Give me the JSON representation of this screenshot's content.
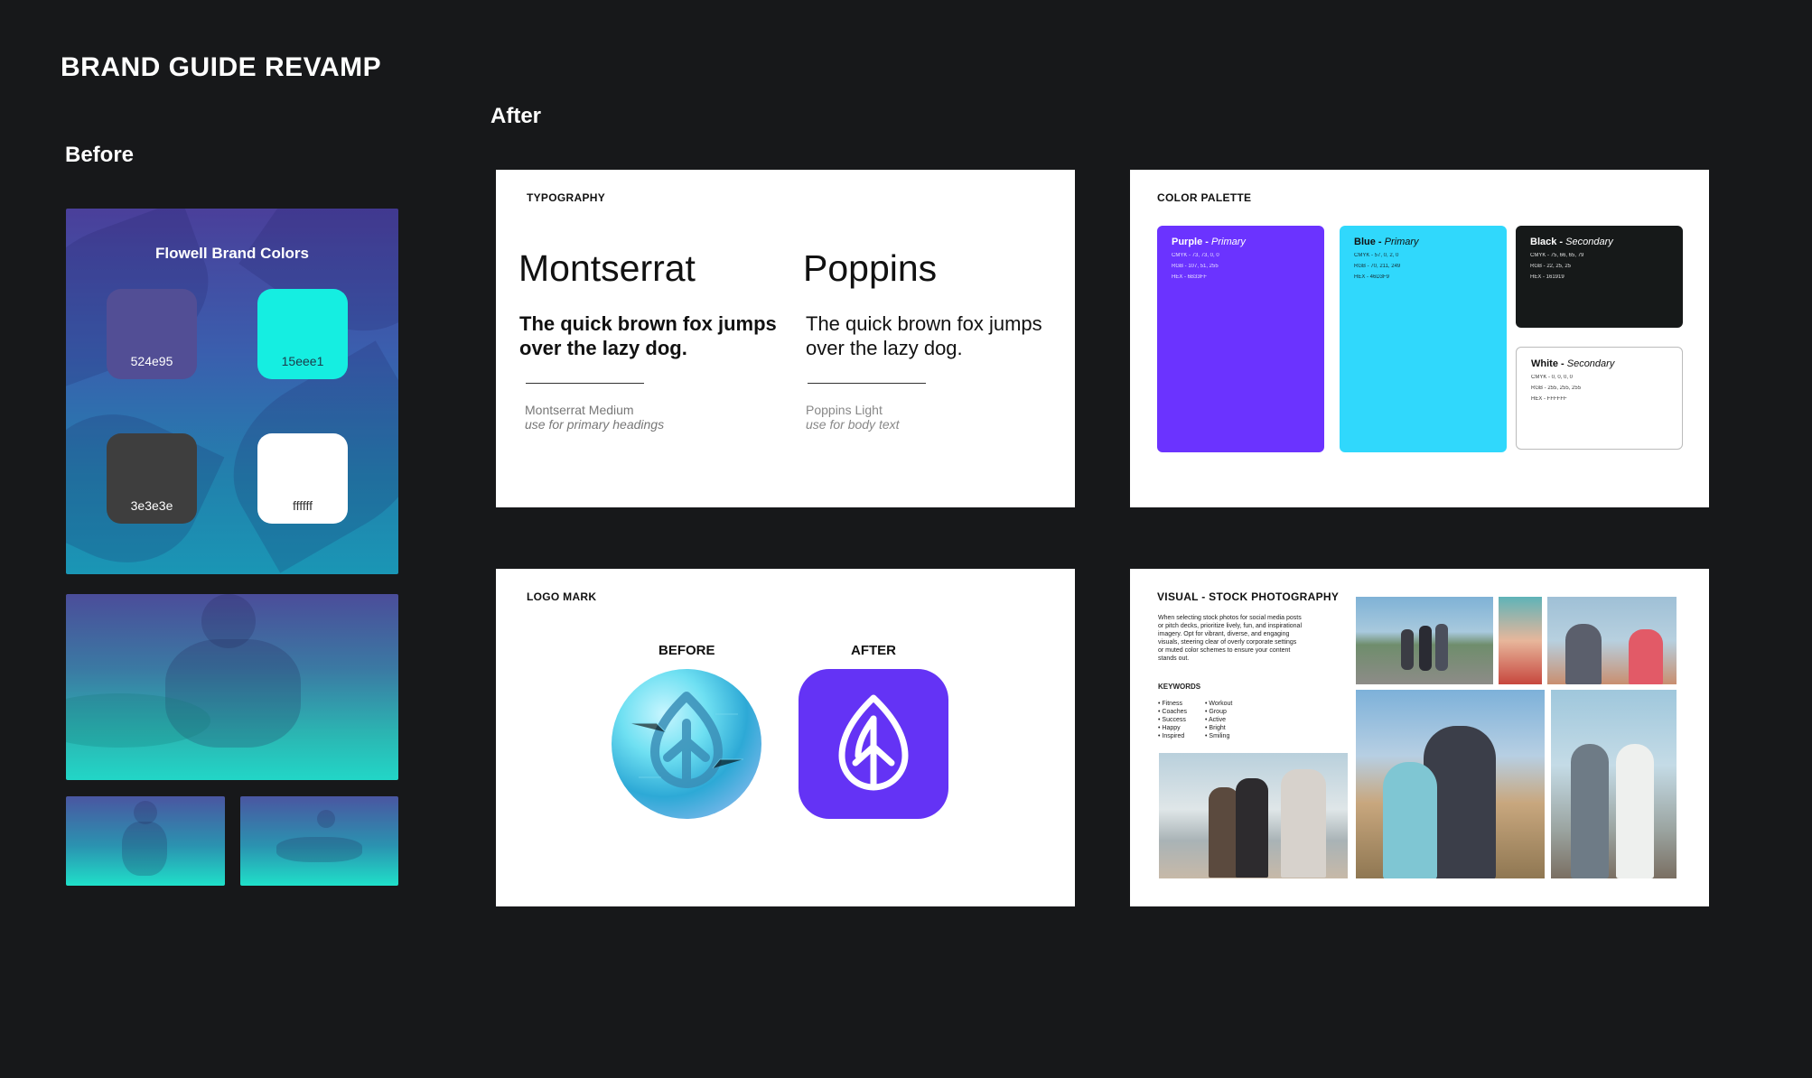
{
  "page": {
    "title": "BRAND GUIDE REVAMP",
    "before_label": "Before",
    "after_label": "After"
  },
  "before": {
    "card_title": "Flowell Brand Colors",
    "swatches": [
      {
        "label": "524e95",
        "color": "#524e95"
      },
      {
        "label": "15eee1",
        "color": "#15eee1"
      },
      {
        "label": "3e3e3e",
        "color": "#3e3e3e"
      },
      {
        "label": "ffffff",
        "color": "#ffffff"
      }
    ]
  },
  "typography": {
    "label": "TYPOGRAPHY",
    "fonts": [
      {
        "name": "Montserrat",
        "sample": "The quick brown fox jumps over the lazy dog.",
        "weight": "Montserrat Medium",
        "usage": "use for primary headings"
      },
      {
        "name": "Poppins",
        "sample": "The quick brown fox jumps over the lazy dog.",
        "weight": "Poppins Light",
        "usage": "use for body text"
      }
    ]
  },
  "palette": {
    "label": "COLOR PALETTE",
    "colors": [
      {
        "name": "Purple",
        "role": "Primary",
        "cmyk": "CMYK - 73, 73, 0, 0",
        "rgb": "RGB - 107, 51, 255",
        "hex": "HEX - 6B33FF",
        "color": "#6b33ff"
      },
      {
        "name": "Blue",
        "role": "Primary",
        "cmyk": "CMYK - 57, 0, 2, 0",
        "rgb": "RGB - 70, 211, 249",
        "hex": "HEX - 46D3F9",
        "color": "#30d8fc"
      },
      {
        "name": "Black",
        "role": "Secondary",
        "cmyk": "CMYK - 75, 66, 65, 79",
        "rgb": "RGB - 22, 25, 25",
        "hex": "HEX - 161919",
        "color": "#161919"
      },
      {
        "name": "White",
        "role": "Secondary",
        "cmyk": "CMYK - 0, 0, 0, 0",
        "rgb": "RGB - 255, 255, 255",
        "hex": "HEX - FFFFFF",
        "color": "#ffffff"
      }
    ]
  },
  "logo": {
    "label": "LOGO MARK",
    "before": "BEFORE",
    "after": "AFTER",
    "icon": "leaf-drop-icon"
  },
  "stock": {
    "label": "VISUAL - STOCK PHOTOGRAPHY",
    "body": "When selecting stock photos for social media posts or pitch decks, prioritize lively, fun, and inspirational imagery. Opt for vibrant, diverse, and engaging visuals, steering clear of overly corporate settings or muted color schemes to ensure your content stands out.",
    "keywords_label": "KEYWORDS",
    "keywords_col1": [
      "• Fitness",
      "• Coaches",
      "• Success",
      "• Happy",
      "• Inspired"
    ],
    "keywords_col2": [
      "• Workout",
      "• Group",
      "• Active",
      "• Bright",
      "• Smiling"
    ]
  }
}
